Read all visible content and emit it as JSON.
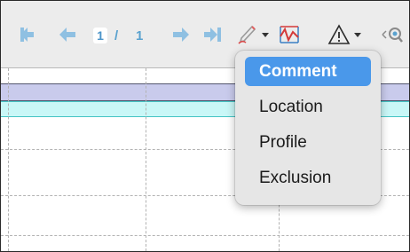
{
  "toolbar": {
    "icons": [
      "first-page-icon",
      "previous-page-icon",
      "next-page-icon",
      "last-page-icon",
      "annotation-pen-icon",
      "chart-icon",
      "warning-icon",
      "zoom-icon"
    ],
    "page_current": "1",
    "page_separator": "/",
    "page_total": "1"
  },
  "menu": {
    "items": [
      {
        "label": "Comment",
        "selected": true
      },
      {
        "label": "Location",
        "selected": false
      },
      {
        "label": "Profile",
        "selected": false
      },
      {
        "label": "Exclusion",
        "selected": false
      }
    ]
  },
  "colors": {
    "selection": "#4a98ea",
    "nav_arrow": "#8fc0e2",
    "row_highlight": "#c9cbec",
    "row_cyan": "#c9f7f7"
  }
}
